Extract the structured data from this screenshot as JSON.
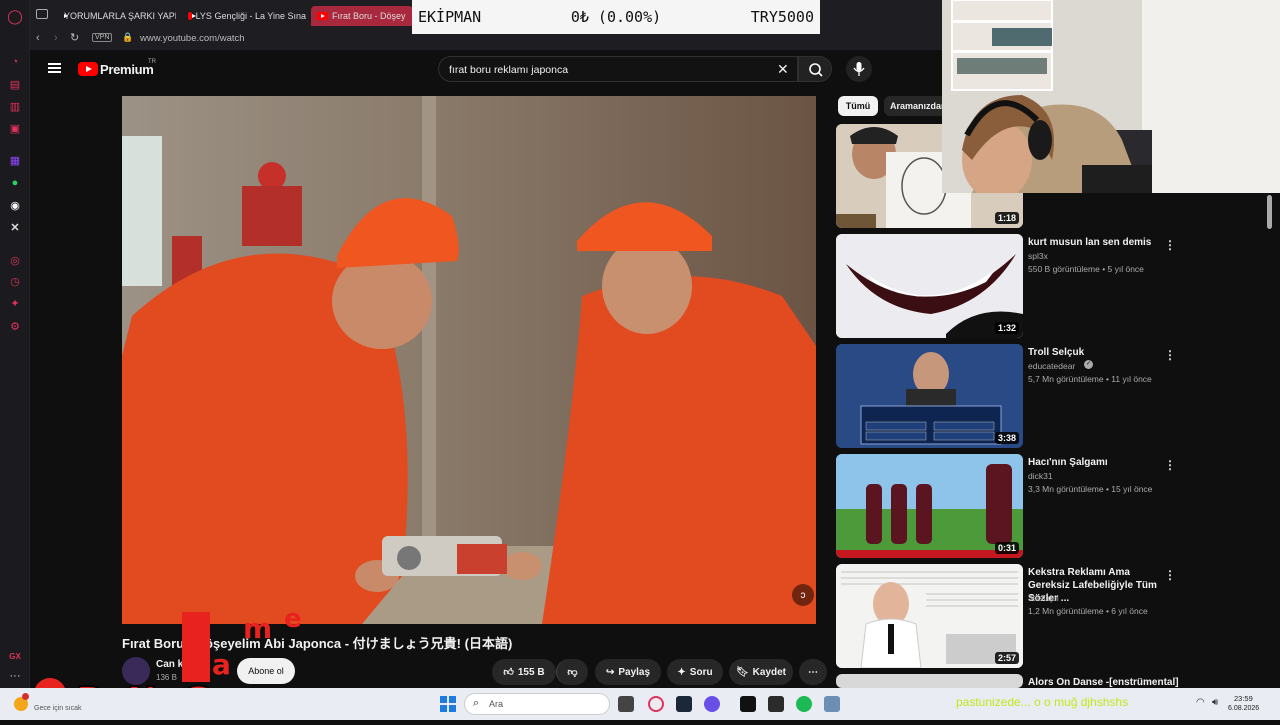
{
  "browser": {
    "tabs": [
      {
        "label": "YORUMLARLA ŞARKI YAPK"
      },
      {
        "label": "LYS Gençliği - La Yine Sına"
      },
      {
        "label": "Fırat Boru - Döşey"
      }
    ],
    "url": "www.youtube.com/watch",
    "vpn_label": "VPN"
  },
  "youtube": {
    "logo": "Premium",
    "logo_region": "TR",
    "search_value": "fırat boru reklamı japonca"
  },
  "stream_overlay": {
    "label": "EKİPMAN",
    "value": "0₺ (0.00%)",
    "target": "TRY5000"
  },
  "filters": {
    "chip_all": "Tümü",
    "chip_related": "Aramanızdan"
  },
  "recommendations": [
    {
      "title": "",
      "channel": "",
      "meta": "",
      "duration": "1:18"
    },
    {
      "title": "kurt musun lan sen demis",
      "channel": "spl3x",
      "meta": "550 B görüntüleme • 5 yıl önce",
      "duration": "1:32"
    },
    {
      "title": "Troll Selçuk",
      "channel": "educatedear",
      "meta": "5,7 Mn görüntüleme • 11 yıl önce",
      "duration": "3:38"
    },
    {
      "title": "Hacı'nın Şalgamı",
      "channel": "dick31",
      "meta": "3,3 Mn görüntüleme • 15 yıl önce",
      "duration": "0:31"
    },
    {
      "title": "Kekstra Reklamı Ama Gereksiz Lafebeliğiyle Tüm Sözler ...",
      "channel": "3tilaliqoi",
      "meta": "1,2 Mn görüntüleme • 6 yıl önce",
      "duration": "2:57"
    },
    {
      "title": "Alors On Danse -[enstrümental]",
      "channel": "",
      "meta": "",
      "duration": ""
    }
  ],
  "video": {
    "title": "Fırat Boru - Döşeyelim Abi Japonca - 付けましょう兄貴! (日本語)",
    "channel_name": "Can k",
    "subscribers": "136 B",
    "subscribe_label": "Abone ol",
    "like_count": "155 B",
    "share_label": "Paylaş",
    "ask_label": "Soru",
    "save_label": "Kaydet"
  },
  "watermark": {
    "text": "ByNoG",
    "letters": [
      "a",
      "m",
      "e"
    ]
  },
  "taskbar": {
    "search_placeholder": "Ara",
    "ticker": "pastunizede...  o o muğ djhshshs",
    "time": "23:59",
    "date": "6.08.2026",
    "weather_hint": "Gece için sıcak"
  },
  "colors": {
    "accent_red": "#ff0000",
    "opera_red": "#e0325a",
    "workwear_orange": "#e24a1f"
  }
}
